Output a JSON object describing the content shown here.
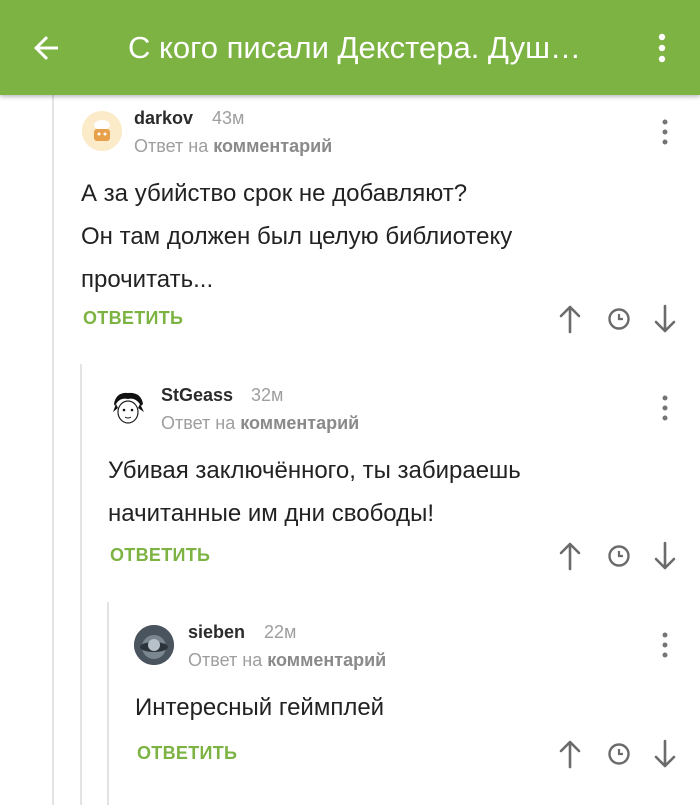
{
  "header": {
    "title": "С кого писали Декстера. Душ…",
    "back_icon": "arrow-left-icon",
    "menu_icon": "more-vertical-icon"
  },
  "comments": [
    {
      "username": "darkov",
      "time": "43м",
      "reply_prefix": "Ответ на",
      "reply_target": "комментарий",
      "text_lines": [
        "А за убийство срок не добавляют?",
        "Он там должен был целую библиотеку",
        "прочитать..."
      ],
      "reply_label": "ОТВЕТИТЬ"
    },
    {
      "username": "StGeass",
      "time": "32м",
      "reply_prefix": "Ответ на",
      "reply_target": "комментарий",
      "text_lines": [
        "Убивая заключённого, ты забираешь",
        "начитанные им дни свободы!"
      ],
      "reply_label": "ОТВЕТИТЬ"
    },
    {
      "username": "sieben",
      "time": "22м",
      "reply_prefix": "Ответ на",
      "reply_target": "комментарий",
      "text_lines": [
        "Интересный геймплей"
      ],
      "reply_label": "ОТВЕТИТЬ"
    }
  ],
  "colors": {
    "accent": "#7cb342",
    "muted": "#9e9e9e",
    "line": "#e3e3e3"
  }
}
